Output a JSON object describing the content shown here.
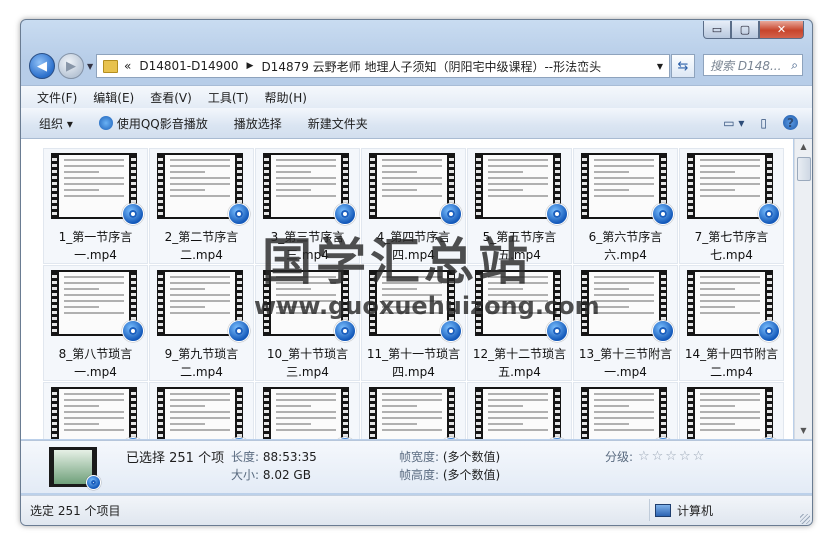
{
  "window": {
    "buttons": {
      "minimize": "▭",
      "maximize": "▢",
      "close": "✕"
    }
  },
  "nav": {
    "back": "◀",
    "forward": "▶"
  },
  "address": {
    "overflow": "«",
    "crumbs": [
      "D14801-D14900",
      "D14879 云野老师 地理人子须知（阴阳宅中级课程）--形法峦头"
    ],
    "separator": "▶"
  },
  "search": {
    "placeholder": "搜索 D148..."
  },
  "menu": [
    "文件(F)",
    "编辑(E)",
    "查看(V)",
    "工具(T)",
    "帮助(H)"
  ],
  "toolbar": {
    "organize": "组织 ▾",
    "play_qq": "使用QQ影音播放",
    "play_selection": "播放选择",
    "new_folder": "新建文件夹",
    "help": "?"
  },
  "files": [
    {
      "name": "1_第一节序言一.mp4"
    },
    {
      "name": "2_第二节序言二.mp4"
    },
    {
      "name": "3_第三节序言三.mp4"
    },
    {
      "name": "4_第四节序言四.mp4"
    },
    {
      "name": "5_第五节序言五.mp4"
    },
    {
      "name": "6_第六节序言六.mp4"
    },
    {
      "name": "7_第七节序言七.mp4"
    },
    {
      "name": "8_第八节琐言一.mp4"
    },
    {
      "name": "9_第九节琐言二.mp4"
    },
    {
      "name": "10_第十节琐言三.mp4"
    },
    {
      "name": "11_第十一节琐言四.mp4"
    },
    {
      "name": "12_第十二节琐言五.mp4"
    },
    {
      "name": "13_第十三节附言一.mp4"
    },
    {
      "name": "14_第十四节附言二.mp4"
    },
    {
      "name": ""
    },
    {
      "name": ""
    },
    {
      "name": ""
    },
    {
      "name": ""
    },
    {
      "name": ""
    },
    {
      "name": ""
    },
    {
      "name": ""
    }
  ],
  "details": {
    "selected": "已选择 251 个项",
    "length_label": "长度:",
    "length_value": "88:53:35",
    "size_label": "大小:",
    "size_value": "8.02 GB",
    "width_label": "帧宽度:",
    "width_value": "(多个数值)",
    "height_label": "帧高度:",
    "height_value": "(多个数值)",
    "rating_label": "分级:",
    "rating_stars": "☆☆☆☆☆",
    "rating": 0
  },
  "status": {
    "left": "选定 251 个项目",
    "right": "计算机"
  },
  "watermark": {
    "cn": "国学汇总站",
    "url": "www.guoxuehuizong.com"
  }
}
